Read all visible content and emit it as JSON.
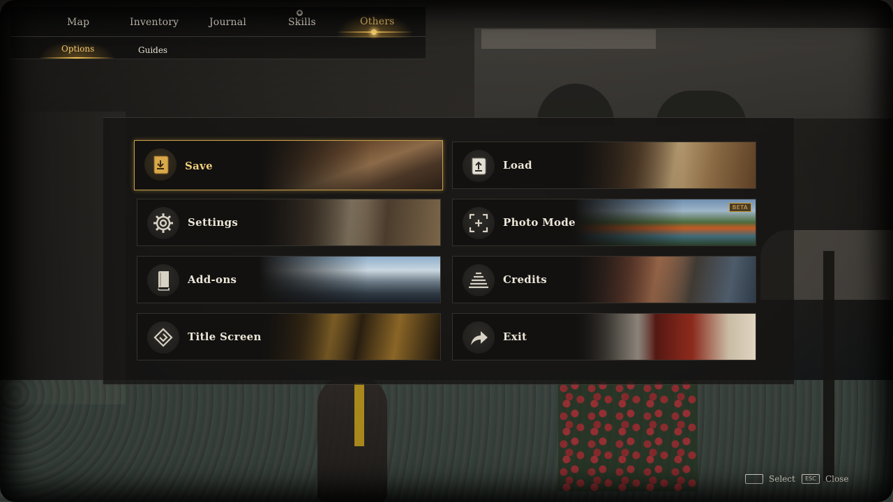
{
  "nav": {
    "tabs": [
      {
        "label": "Map"
      },
      {
        "label": "Inventory"
      },
      {
        "label": "Journal"
      },
      {
        "label": "Skills"
      },
      {
        "label": "Others",
        "active": true
      }
    ],
    "subtabs": [
      {
        "label": "Options",
        "active": true
      },
      {
        "label": "Guides"
      }
    ]
  },
  "menu": {
    "cards": [
      {
        "label": "Save",
        "icon": "save-scroll-icon",
        "selected": true
      },
      {
        "label": "Load",
        "icon": "load-scroll-icon"
      },
      {
        "label": "Settings",
        "icon": "gear-icon"
      },
      {
        "label": "Photo Mode",
        "icon": "camera-frame-icon",
        "badge": "BETA"
      },
      {
        "label": "Add-ons",
        "icon": "book-icon"
      },
      {
        "label": "Credits",
        "icon": "scroll-lines-icon"
      },
      {
        "label": "Title Screen",
        "icon": "diamond-emblem-icon"
      },
      {
        "label": "Exit",
        "icon": "exit-arrow-icon"
      }
    ]
  },
  "footer": {
    "select": {
      "key": "",
      "label": "Select"
    },
    "close": {
      "key": "ESC",
      "label": "Close"
    }
  },
  "colors": {
    "accent": "#f2c86a",
    "selected_border": "#c9a04a",
    "text": "#ece6d8"
  }
}
